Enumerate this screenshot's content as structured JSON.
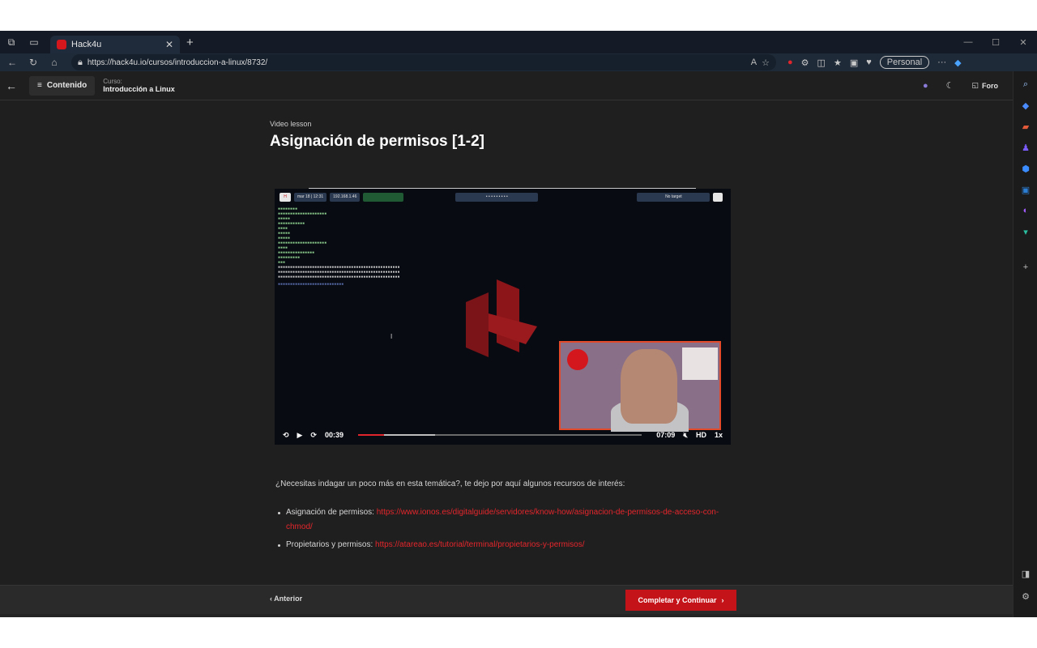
{
  "browser": {
    "tab_title": "Hack4u",
    "url": "https://hack4u.io/cursos/introduccion-a-linux/8732/",
    "profile_label": "Personal"
  },
  "app": {
    "contenido_label": "Contenido",
    "course_key": "Curso:",
    "course_name": "Introducción a Linux",
    "foro_label": "Foro"
  },
  "lesson": {
    "type": "Video lesson",
    "title": "Asignación de permisos [1-2]"
  },
  "player": {
    "current_time": "00:39",
    "duration": "07:09",
    "quality": "HD",
    "speed": "1x",
    "progress_played": 0.09,
    "progress_buffered": 0.27,
    "terminal_top": {
      "clock": "mar 18 | 12:31",
      "ip": "192.168.1.46",
      "target": "No target"
    }
  },
  "description": "¿Necesitas indagar un poco más en esta temática?, te dejo por aquí algunos recursos de interés:",
  "resources": [
    {
      "label": "Asignación de permisos: ",
      "link": "https://www.ionos.es/digitalguide/servidores/know-how/asignacion-de-permisos-de-acceso-con-chmod/"
    },
    {
      "label": "Propietarios y permisos: ",
      "link": "https://atareao.es/tutorial/terminal/propietarios-y-permisos/"
    }
  ],
  "footer": {
    "prev_label": "Anterior",
    "next_label": "Completar y Continuar"
  },
  "colors": {
    "accent": "#c4141a",
    "link": "#e5262c",
    "background": "#1f1f1f"
  }
}
